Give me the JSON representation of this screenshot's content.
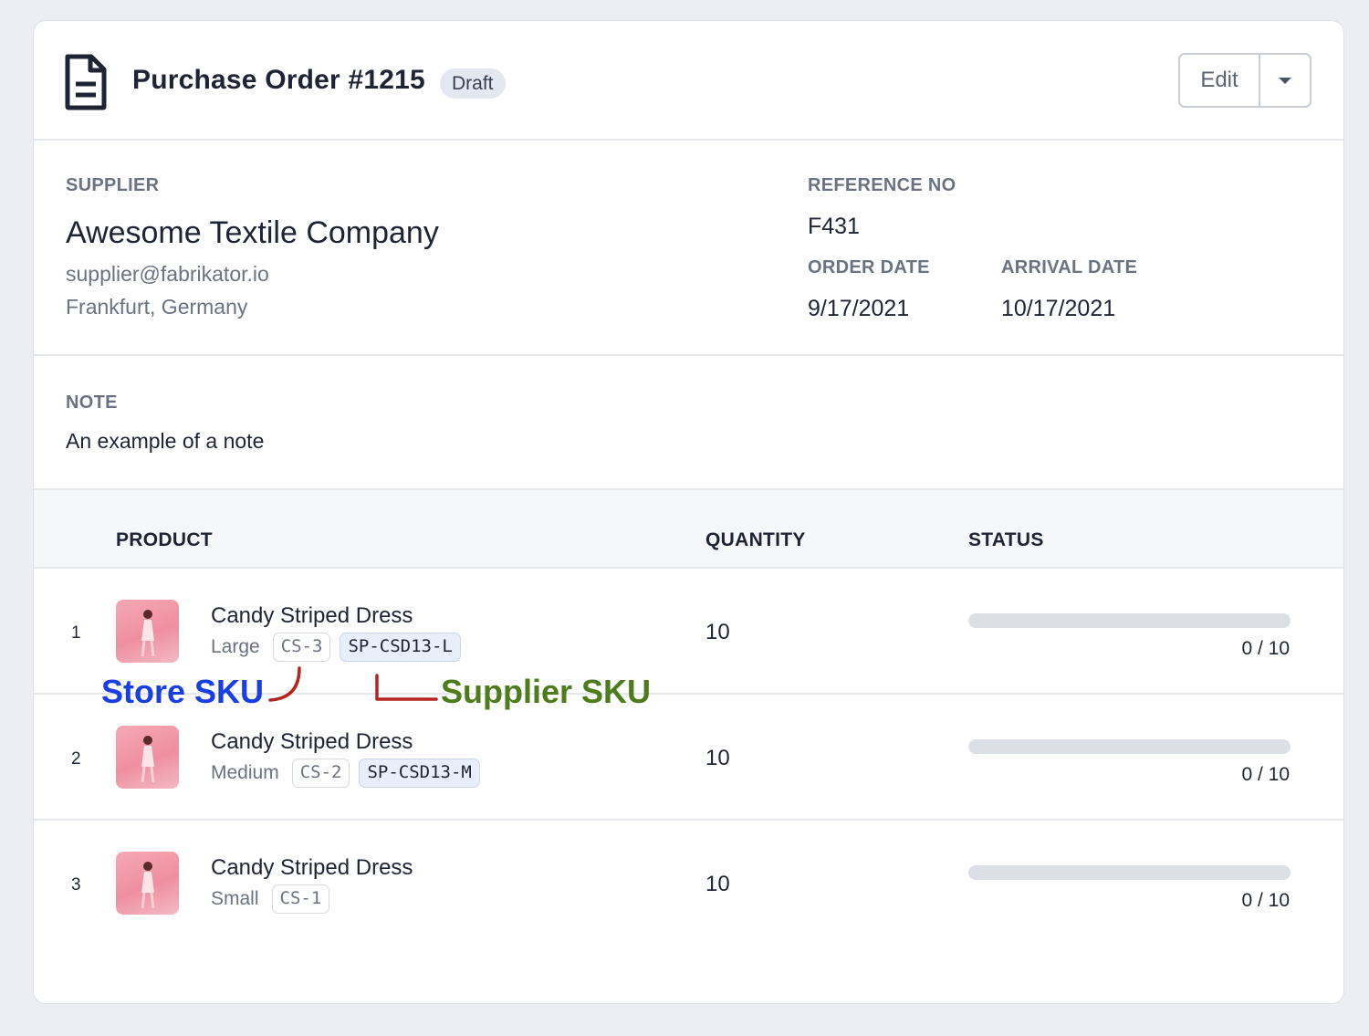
{
  "header": {
    "title": "Purchase Order #1215",
    "status_badge": "Draft",
    "edit_label": "Edit",
    "icon": "document-icon"
  },
  "supplier": {
    "label": "SUPPLIER",
    "name": "Awesome Textile Company",
    "email": "supplier@fabrikator.io",
    "location": "Frankfurt, Germany"
  },
  "reference": {
    "label": "REFERENCE NO",
    "value": "F431"
  },
  "order_date": {
    "label": "ORDER DATE",
    "value": "9/17/2021"
  },
  "arrival_date": {
    "label": "ARRIVAL DATE",
    "value": "10/17/2021"
  },
  "note": {
    "label": "NOTE",
    "text": "An example of a note"
  },
  "table": {
    "columns": [
      "PRODUCT",
      "QUANTITY",
      "STATUS"
    ],
    "rows": [
      {
        "index": "1",
        "name": "Candy Striped Dress",
        "variant": "Large",
        "store_sku": "CS-3",
        "supplier_sku": "SP-CSD13-L",
        "quantity": "10",
        "received": 0,
        "total": 10,
        "progress_text": "0 / 10"
      },
      {
        "index": "2",
        "name": "Candy Striped Dress",
        "variant": "Medium",
        "store_sku": "CS-2",
        "supplier_sku": "SP-CSD13-M",
        "quantity": "10",
        "received": 0,
        "total": 10,
        "progress_text": "0 / 10"
      },
      {
        "index": "3",
        "name": "Candy Striped Dress",
        "variant": "Small",
        "store_sku": "CS-1",
        "supplier_sku": "",
        "quantity": "10",
        "received": 0,
        "total": 10,
        "progress_text": "0 / 10"
      }
    ]
  },
  "annotations": {
    "store_sku": "Store SKU",
    "supplier_sku": "Supplier SKU"
  },
  "colors": {
    "store_annotation": "#1a3fe0",
    "supplier_annotation": "#4e7b1c",
    "arrow": "#b3261e",
    "supplier_sku_bg": "#e8effb"
  }
}
